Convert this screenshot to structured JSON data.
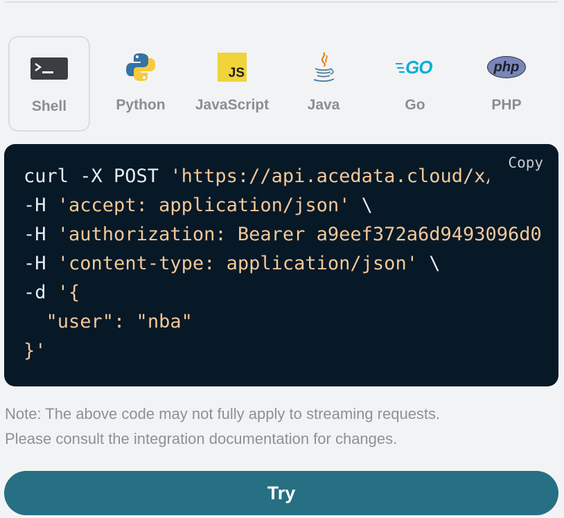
{
  "languages": [
    {
      "label": "Shell",
      "icon": "terminal-icon",
      "active": true
    },
    {
      "label": "Python",
      "icon": "python-icon",
      "active": false
    },
    {
      "label": "JavaScript",
      "icon": "javascript-icon",
      "active": false
    },
    {
      "label": "Java",
      "icon": "java-icon",
      "active": false
    },
    {
      "label": "Go",
      "icon": "go-icon",
      "active": false
    },
    {
      "label": "PHP",
      "icon": "php-icon",
      "active": false
    }
  ],
  "icon_text": {
    "javascript": "JS",
    "go": "GO",
    "php": "php"
  },
  "code": {
    "copy_label": "Copy",
    "lines": [
      {
        "cmd": "curl -X POST ",
        "str": "'https://api.acedata.cloud/x/user"
      },
      {
        "cmd": "-H ",
        "str": "'accept: application/json'",
        "tail": " \\"
      },
      {
        "cmd": "-H ",
        "str": "'authorization: Bearer a9eef372a6d9493096d0"
      },
      {
        "cmd": "-H ",
        "str": "'content-type: application/json'",
        "tail": " \\"
      },
      {
        "cmd": "-d ",
        "str": "'{"
      },
      {
        "cmd": "  ",
        "str": "\"user\": \"nba\""
      },
      {
        "cmd": "",
        "str": "}'"
      }
    ]
  },
  "note": {
    "line1": "Note: The above code may not fully apply to streaming requests.",
    "line2": "Please consult the integration documentation for changes."
  },
  "try_label": "Try",
  "colors": {
    "background": "#f2f3f5",
    "code_background": "#071827",
    "code_string": "#f3c897",
    "try_button": "#276f83"
  }
}
